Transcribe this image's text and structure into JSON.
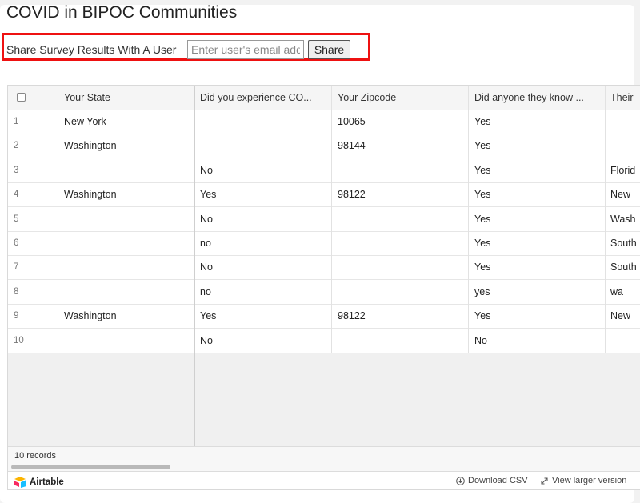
{
  "page": {
    "title": "COVID in BIPOC Communities"
  },
  "share": {
    "label": "Share Survey Results With A User",
    "input_placeholder": "Enter user's email address",
    "input_value": "",
    "button_label": "Share",
    "highlight_color": "#ee1111"
  },
  "table": {
    "columns": [
      "Your State",
      "Did you experience CO...",
      "Your Zipcode",
      "Did anyone they know ...",
      "Their"
    ],
    "rows": [
      {
        "num": "1",
        "cells": [
          "New York",
          "",
          "10065",
          "Yes",
          ""
        ]
      },
      {
        "num": "2",
        "cells": [
          "Washington",
          "",
          "98144",
          "Yes",
          ""
        ]
      },
      {
        "num": "3",
        "cells": [
          "",
          "No",
          "",
          "Yes",
          "Florid"
        ]
      },
      {
        "num": "4",
        "cells": [
          "Washington",
          "Yes",
          "98122",
          "Yes",
          "New"
        ]
      },
      {
        "num": "5",
        "cells": [
          "",
          "No",
          "",
          "Yes",
          "Wash"
        ]
      },
      {
        "num": "6",
        "cells": [
          "",
          "no",
          "",
          "Yes",
          "South"
        ]
      },
      {
        "num": "7",
        "cells": [
          "",
          "No",
          "",
          "Yes",
          "South"
        ]
      },
      {
        "num": "8",
        "cells": [
          "",
          "no",
          "",
          "yes",
          "wa"
        ]
      },
      {
        "num": "9",
        "cells": [
          "Washington",
          "Yes",
          "98122",
          "Yes",
          "New"
        ]
      },
      {
        "num": "10",
        "cells": [
          "",
          "No",
          "",
          "No",
          ""
        ]
      }
    ],
    "record_count": "10 records"
  },
  "footer": {
    "logo_text": "Airtable",
    "download_label": "Download CSV",
    "view_larger_label": "View larger version",
    "icons": {
      "download": "download-icon",
      "expand": "expand-arrows-icon"
    }
  }
}
